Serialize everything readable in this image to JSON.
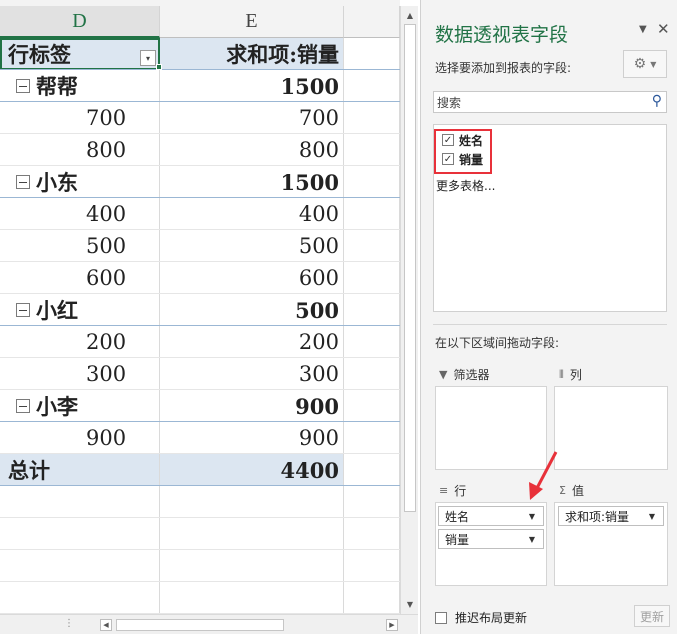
{
  "sheet": {
    "col_d": "D",
    "col_e": "E",
    "header_row": {
      "label": "行标签",
      "value": "求和项:销量"
    },
    "rows": [
      {
        "label": "帮帮",
        "value": "1500"
      },
      {
        "label": "700",
        "value": "700"
      },
      {
        "label": "800",
        "value": "800"
      },
      {
        "label": "小东",
        "value": "1500"
      },
      {
        "label": "400",
        "value": "400"
      },
      {
        "label": "500",
        "value": "500"
      },
      {
        "label": "600",
        "value": "600"
      },
      {
        "label": "小红",
        "value": "500"
      },
      {
        "label": "200",
        "value": "200"
      },
      {
        "label": "300",
        "value": "300"
      },
      {
        "label": "小李",
        "value": "900"
      },
      {
        "label": "900",
        "value": "900"
      }
    ],
    "total_row": {
      "label": "总计",
      "value": "4400"
    },
    "hscroll_dots": "⋮"
  },
  "pane": {
    "title": "数据透视表字段",
    "subtitle": "选择要添加到报表的字段:",
    "search_placeholder": "搜索",
    "fields": [
      {
        "label": "姓名",
        "checked": true
      },
      {
        "label": "销量",
        "checked": true
      }
    ],
    "more_tables": "更多表格...",
    "drag_label": "在以下区域间拖动字段:",
    "areas": {
      "filters": {
        "label": "筛选器"
      },
      "columns": {
        "label": "列"
      },
      "rows": {
        "label": "行",
        "items": [
          "姓名",
          "销量"
        ]
      },
      "values": {
        "label": "值",
        "items": [
          "求和项:销量"
        ]
      }
    },
    "defer_label": "推迟布局更新",
    "update_label": "更新"
  },
  "colors": {
    "accent": "#217346",
    "highlight": "#e8313a",
    "pivot_band": "#dce6f1"
  }
}
